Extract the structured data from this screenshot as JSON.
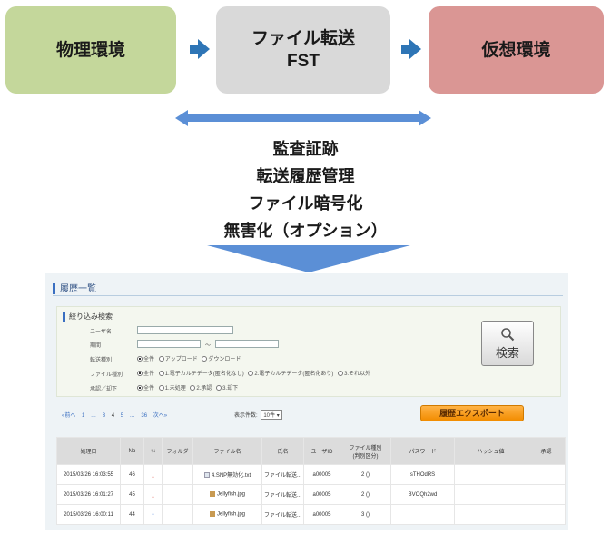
{
  "flow": {
    "physical": "物理環境",
    "fst_line1": "ファイル転送",
    "fst_line2": "FST",
    "virtual": "仮想環境"
  },
  "features": [
    "監査証跡",
    "転送履歴管理",
    "ファイル暗号化",
    "無害化（オプション）"
  ],
  "colors": {
    "physical": "#c4d79b",
    "fst": "#d9d9d9",
    "virtual": "#da9694",
    "arrow": "#2e75b6",
    "export": "#f28c00"
  },
  "panel": {
    "title": "履歴一覧",
    "search_title": "絞り込み検索",
    "fields": {
      "user_label": "ユーザ名",
      "date_label": "期間",
      "date_sep": "～",
      "transfer_type_label": "転送種別",
      "transfer_type_options": [
        "全件",
        "アップロード",
        "ダウンロード"
      ],
      "file_type_label": "ファイル種別",
      "file_type_options": [
        "全件",
        "1.電子カルテデータ(匿名化なし)",
        "2.電子カルテデータ(匿名化あり)",
        "3.それ以外"
      ],
      "approval_label": "承認／却下",
      "approval_options": [
        "全件",
        "1.未処理",
        "2.承認",
        "3.却下"
      ]
    },
    "search_button": "検索",
    "pager": [
      "«前へ",
      "1",
      "…",
      "3",
      "4",
      "5",
      "…",
      "36",
      "次へ»"
    ],
    "per_page_label": "表示件数:",
    "per_page_value": "10件",
    "export_button": "履歴エクスポート",
    "table": {
      "headers": [
        "処理日",
        "No",
        "↑↓",
        "フォルダ",
        "ファイル名",
        "氏名",
        "ユーザID",
        "ファイル種別\n(判別区分)",
        "パスワード",
        "ハッシュ値",
        "承認"
      ],
      "rows": [
        {
          "date": "2015/03/26 16:03:55",
          "no": "46",
          "dir": "down",
          "folder": "",
          "file": "4.SNP無効化.txt",
          "name": "ファイル転送...",
          "user": "a00005",
          "type": "2 ()",
          "password": "sTHOdRS",
          "hash": "",
          "approval": ""
        },
        {
          "date": "2015/03/26 16:01:27",
          "no": "45",
          "dir": "down",
          "folder": "",
          "file": "Jellyfish.jpg",
          "name": "ファイル転送...",
          "user": "a00005",
          "type": "2 ()",
          "password": "BVOQh2wd",
          "hash": "",
          "approval": ""
        },
        {
          "date": "2015/03/26 16:00:11",
          "no": "44",
          "dir": "up",
          "folder": "",
          "file": "Jellyfish.jpg",
          "name": "ファイル転送...",
          "user": "a00005",
          "type": "3 ()",
          "password": "",
          "hash": "",
          "approval": ""
        }
      ]
    }
  }
}
